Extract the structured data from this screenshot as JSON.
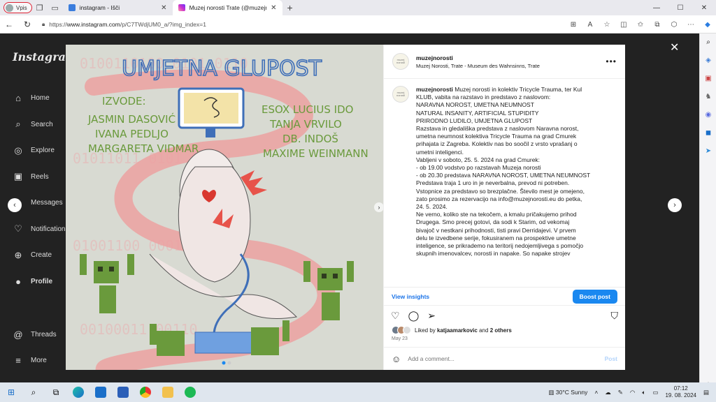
{
  "browser": {
    "profile_label": "Vpis",
    "tabs": [
      {
        "title": "instagram - Išči",
        "active": false
      },
      {
        "title": "Muzej norosti Trate (@muzejnoro",
        "active": true
      }
    ],
    "url_prefix": "https://",
    "url_host": "www.instagram.com",
    "url_path": "/p/C7TWdjUM0_a/?img_index=1"
  },
  "instagram": {
    "logo": "Instagram",
    "nav": [
      {
        "label": "Home",
        "icon": "home-icon",
        "glyph": "⌂"
      },
      {
        "label": "Search",
        "icon": "search-icon",
        "glyph": "⌕"
      },
      {
        "label": "Explore",
        "icon": "explore-icon",
        "glyph": "◎"
      },
      {
        "label": "Reels",
        "icon": "reels-icon",
        "glyph": "▣"
      },
      {
        "label": "Messages",
        "icon": "messages-icon",
        "glyph": "✈"
      },
      {
        "label": "Notifications",
        "icon": "heart-icon",
        "glyph": "♡"
      },
      {
        "label": "Create",
        "icon": "create-icon",
        "glyph": "⊕"
      },
      {
        "label": "Profile",
        "icon": "profile-avatar-icon",
        "glyph": "●"
      }
    ],
    "bottom_nav": [
      {
        "label": "Threads",
        "icon": "threads-icon",
        "glyph": "@"
      },
      {
        "label": "More",
        "icon": "menu-icon",
        "glyph": "≡"
      }
    ]
  },
  "post": {
    "image": {
      "title": "UMJETNA GLUPOST",
      "izvode_label": "IZVODE:",
      "left_names": [
        "JASMIN DASOVIĆ",
        "IVANA PEDLJO",
        "MARGARETA VIDMAR"
      ],
      "right_names": [
        "ESOX LUCIUS IDO",
        "TANJA VRVILO",
        "DB. INDOŠ",
        "MAXIME WEINMANN"
      ]
    },
    "username": "muzejnorosti",
    "location": "Muzej Norosti, Trate - Museum des Wahnsinns, Trate",
    "avatar_text": "muzej norosti",
    "caption_user": "muzejnorosti",
    "caption_lines": [
      "Muzej norosti in kolektiv Tricycle Trauma, ter Kul",
      "KLUB, vabita na razstavo in predstavo z naslovom:",
      "NARAVNA NOROST, UMETNA NEUMNOST",
      "NATURAL INSANITY, ARTIFICIAL STUPIDITY",
      "PRIRODNO LUDILO, UMJETNA GLUPOST",
      "Razstava in gledališka predstava z naslovom Naravna norost,",
      "umetna neumnost kolektiva Tricycle Trauma na grad Cmurek",
      "prihajata iz Zagreba. Kolektiv nas bo soočil z vrsto vprašanj o",
      "umetni inteligenci.",
      "Vabljeni v soboto, 25. 5. 2024 na grad Cmurek:",
      "- ob 19.00 vodstvo po razstavah Muzeja norosti",
      "- ob 20.30 predstava NARAVNA NOROST, UMETNA NEUMNOST",
      "Predstava traja 1 uro in je neverbalna, prevod ni potreben.",
      "Vstopnice za predstavo so brezplačne. Število mest je omejeno,",
      "zato prosimo za rezervacijo na info@muzejnorosti.eu do petka,",
      "24. 5. 2024.",
      "Ne verno, koliko ste na tekočem, a kmalu pričakujemo prihod",
      "Drugega. Smo precej gotovi, da sodi k Starim, od vekomaj",
      "bivajoč v nestkani prihodnosti, tisti pravi Derridajevi. V prvem",
      "delu te izvedbene serije, fokusiranem na prospektive umetne",
      "inteligence, se prikrademo na teritorij nedojemljivega s pomočjo",
      "skupnih imenovalcev, norosti in napake. So napake strojev"
    ],
    "view_insights": "View insights",
    "boost_post": "Boost post",
    "liked_by_prefix": "Liked by",
    "liked_by_user": "katjaamarkovic",
    "liked_by_and": "and",
    "liked_by_others": "2 others",
    "date": "May 23",
    "comment_placeholder": "Add a comment...",
    "post_label": "Post"
  },
  "taskbar": {
    "weather": "30°C  Sunny",
    "time": "07:12",
    "date": "19. 08. 2024"
  },
  "colors": {
    "instagram_blue": "#1a88f0",
    "poster_green": "#6a9a3c",
    "poster_blue": "#3f6fb8",
    "poster_pink": "#e89a9a"
  }
}
